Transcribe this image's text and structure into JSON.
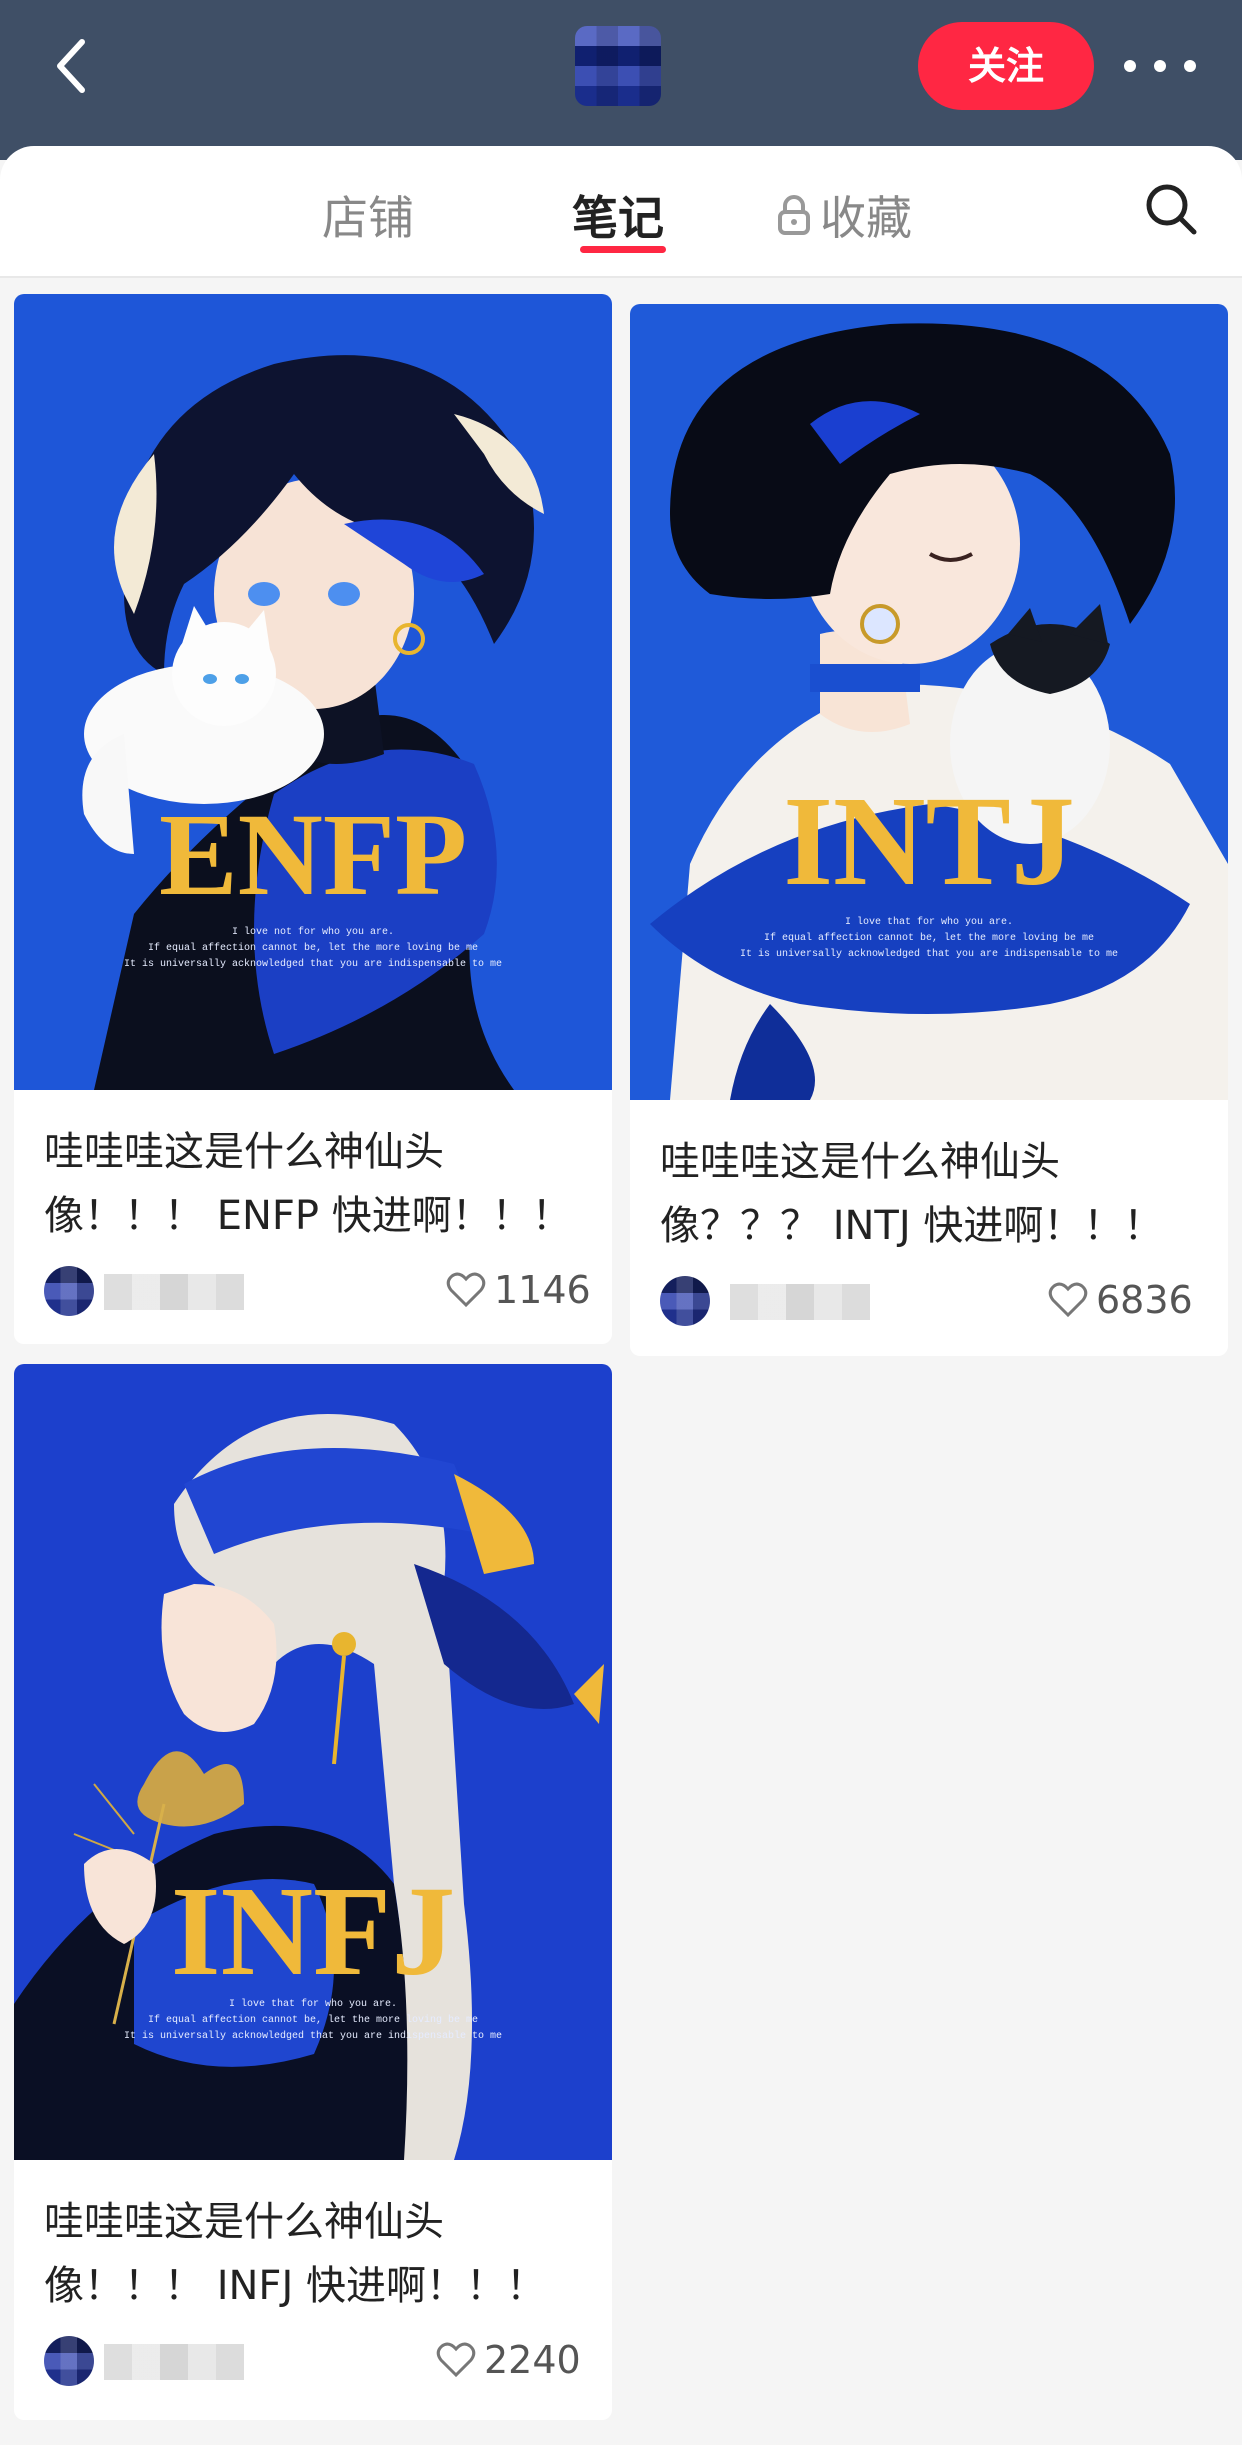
{
  "header": {
    "follow_label": "关注"
  },
  "tabs": {
    "shop": "店铺",
    "notes": "笔记",
    "favorites": "收藏"
  },
  "notes": [
    {
      "title_line1": "哇哇哇这是什么神仙头",
      "title_line2": "像！！！ ENFP 快进啊！！！",
      "likes": "1146",
      "cover_word": "ENFP",
      "cover_caption": [
        "I love not for who you are.",
        "If equal affection cannot be, let the more loving be me",
        "It is universally acknowledged that you are indispensable to me"
      ]
    },
    {
      "title_line1": "哇哇哇这是什么神仙头",
      "title_line2": "像？？？ INTJ 快进啊！！！",
      "likes": "6836",
      "cover_word": "INTJ",
      "cover_caption": [
        "I love that for who you are.",
        "If equal affection cannot be, let the more loving be me",
        "It is universally acknowledged that you are indispensable to me"
      ]
    },
    {
      "title_line1": "哇哇哇这是什么神仙头",
      "title_line2": "像！！！ INFJ 快进啊！！！",
      "likes": "2240",
      "cover_word": "INFJ",
      "cover_caption": [
        "I love that for who you are.",
        "If equal affection cannot be, let the more loving be me",
        "It is universally acknowledged that you are indispensable to me"
      ]
    }
  ],
  "colors": {
    "header_bg": "#3f4f66",
    "accent": "#ff2743",
    "cover_blue": "#1f55d6",
    "cover_gold": "#f0b93a"
  },
  "icons": [
    "back-chevron-icon",
    "more-dots-icon",
    "lock-icon",
    "search-icon",
    "heart-icon"
  ]
}
